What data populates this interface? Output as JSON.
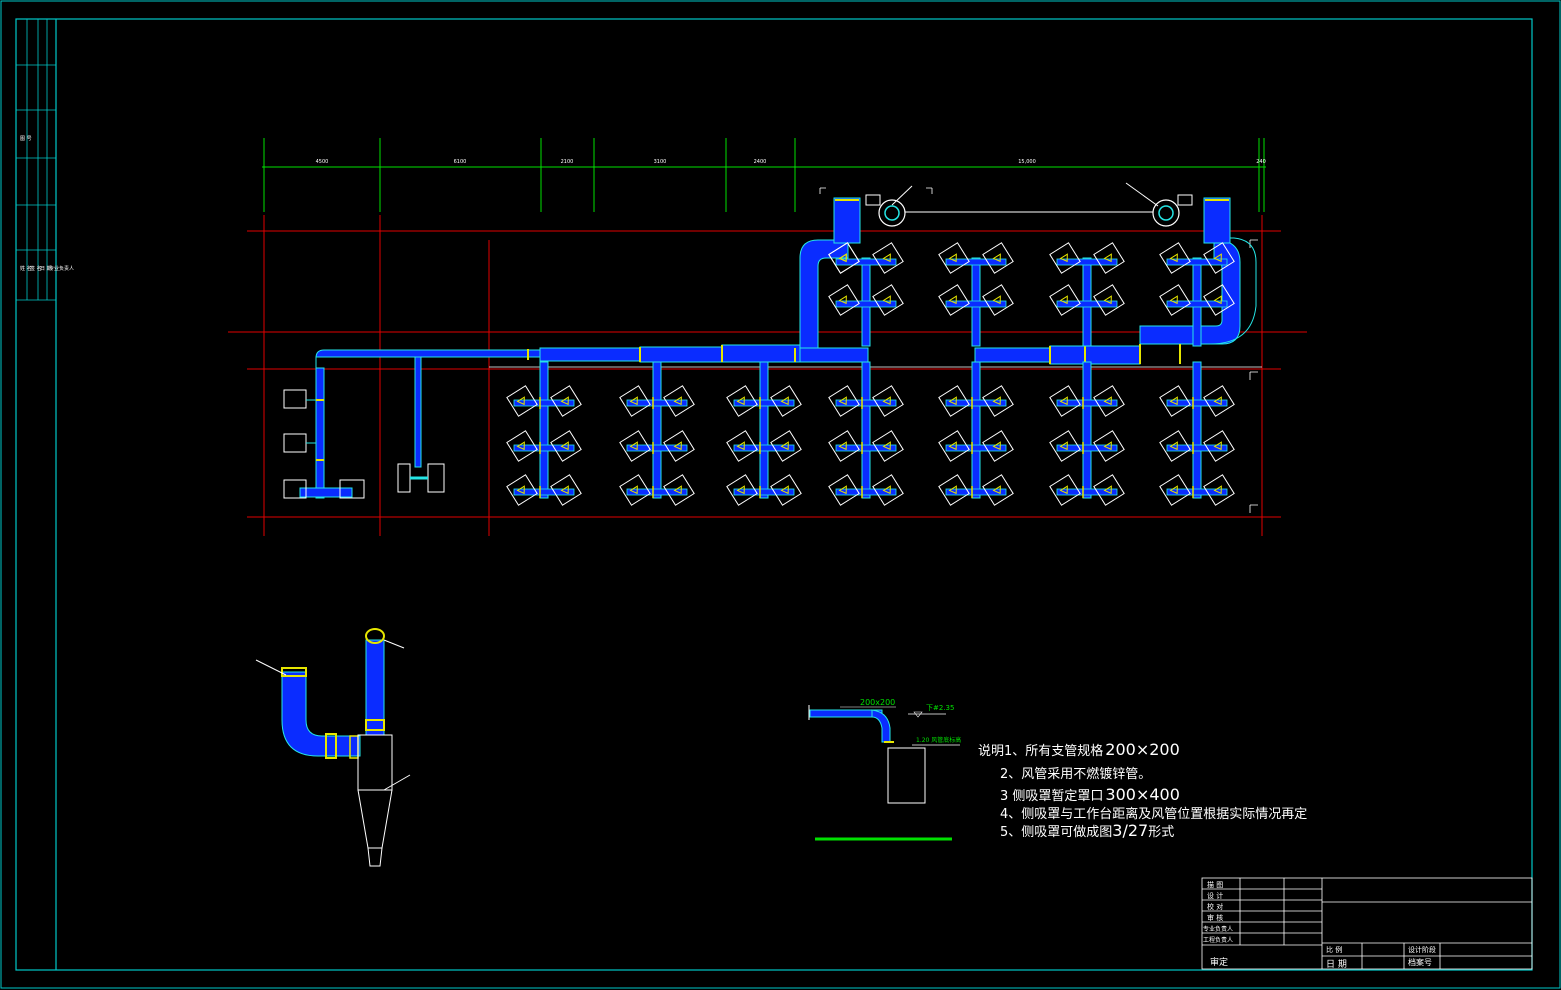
{
  "plan": {
    "dimensions": [
      "4500",
      "6100",
      "2100",
      "3100",
      "2400",
      "15,000",
      "240"
    ]
  },
  "section": {
    "duct_size": "200x200",
    "top_elevation": "下#2.35",
    "bottom_elevation": "1.20 风管底标高"
  },
  "notes": {
    "line1": "说明1、所有支管规格",
    "line1_value": "200×200",
    "line2": "2、风管采用不燃镀锌管。",
    "line3": "3 侧吸罩暂定罩口",
    "line3_value": "300×400",
    "line4": "4、侧吸罩与工作台距离及风管位置根据实际情况再定",
    "line5": "5、侧吸罩可做成图",
    "line5_value": "3/27",
    "line5_suffix": "形式"
  },
  "title_block": {
    "rows": [
      "描 图",
      "设 计",
      "校 对",
      "审 核",
      "专业负责人",
      "工程负责人"
    ],
    "approve": "审定",
    "scale": "比 例",
    "date": "日 期",
    "stage": "设计阶段",
    "archive": "档案号"
  },
  "side_strip": {
    "text1": "图 号",
    "text2": "姓 名",
    "text3": "签 名",
    "text4": "日 期",
    "text5": "专业负责人"
  },
  "colors": {
    "frame": "#00c8c8",
    "grid": "#e00000",
    "duct": "#0a2cff",
    "duct_edge": "#25e6e6",
    "flange": "#e6e600",
    "dim": "#00e000",
    "white": "#ffffff"
  }
}
